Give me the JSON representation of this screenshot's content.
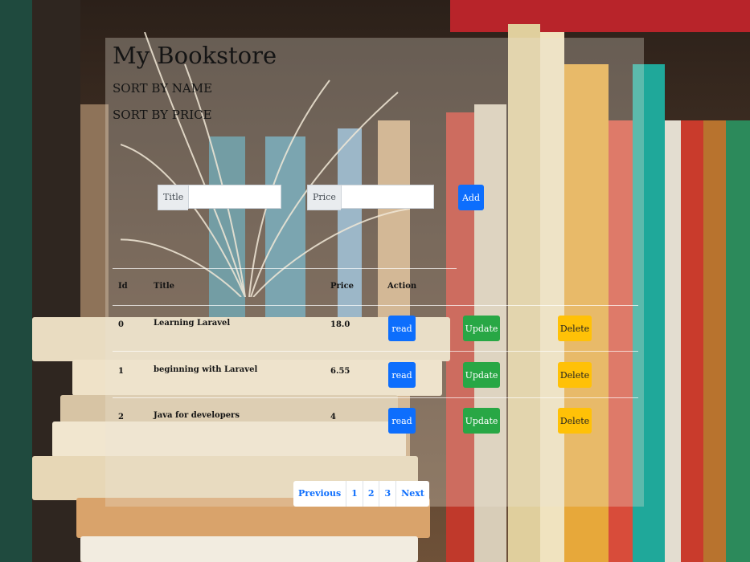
{
  "header": {
    "title": "My Bookstore",
    "sort_by_name": "SORT BY NAME",
    "sort_by_price": "SORT BY PRICE"
  },
  "form": {
    "title_label": "Title",
    "title_value": "",
    "price_label": "Price",
    "price_value": "",
    "add_label": "Add"
  },
  "table": {
    "headers": [
      "Id",
      "Title",
      "Price",
      "Action"
    ],
    "rows": [
      {
        "id": "0",
        "title": "Learning Laravel",
        "price": "18.0",
        "read": "read",
        "update": "Update",
        "delete": "Delete"
      },
      {
        "id": "1",
        "title": "beginning with Laravel",
        "price": "6.55",
        "read": "read",
        "update": "Update",
        "delete": "Delete"
      },
      {
        "id": "2",
        "title": "Java for developers",
        "price": "4",
        "read": "read",
        "update": "Update",
        "delete": "Delete"
      }
    ]
  },
  "pagination": {
    "previous": "Previous",
    "pages": [
      "1",
      "2",
      "3"
    ],
    "next": "Next"
  },
  "colors": {
    "primary": "#0d6efd",
    "success": "#28a745",
    "warning": "#ffc107"
  },
  "icons": [
    "background-bookshelf-image"
  ]
}
